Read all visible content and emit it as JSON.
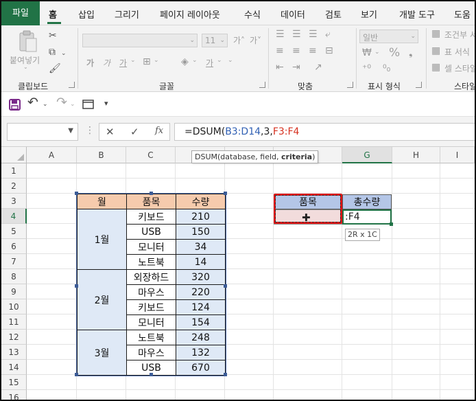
{
  "tabs": [
    "파일",
    "홈",
    "삽입",
    "그리기",
    "페이지 레이아웃",
    "수식",
    "데이터",
    "검토",
    "보기",
    "개발 도구",
    "도움"
  ],
  "ribbon": {
    "clipboard_label": "클립보드",
    "paste_label": "붙여넣기",
    "font_label": "글꼴",
    "font_size": "11",
    "align_label": "맞춤",
    "number_label": "표시 형식",
    "number_format": "일반",
    "style_label": "스타일",
    "cond_format": "조건부 서",
    "table_format": "표 서식",
    "cell_style": "셀 스타일",
    "grow_font": "가˄",
    "shrink_font": "가˅",
    "bold": "가",
    "italic": "가",
    "underline": "가",
    "font_color": "가",
    "percent": "%"
  },
  "quick_access": {
    "icons": [
      "save-icon",
      "undo-icon",
      "redo-icon",
      "window-icon",
      "customize-icon"
    ]
  },
  "formula_bar": {
    "name_box": "",
    "cancel": "✕",
    "enter": "✓",
    "fx": "fx",
    "prefix": "=DSUM(",
    "arg1": "B3:D14",
    "arg2": ",3,",
    "arg3": "F3:F4",
    "tooltip_fn": "DSUM(database, field, ",
    "tooltip_bold": "criteria",
    "tooltip_end": ")"
  },
  "columns": [
    "A",
    "B",
    "C",
    "D",
    "E",
    "F",
    "G",
    "H",
    "I"
  ],
  "rows": [
    "1",
    "2",
    "3",
    "4",
    "5",
    "6",
    "7",
    "8",
    "9",
    "10",
    "11",
    "12",
    "13",
    "14",
    "15",
    "16"
  ],
  "table": {
    "headers": [
      "월",
      "품목",
      "수량"
    ],
    "months": [
      "1월",
      "2월",
      "3월"
    ],
    "items": [
      "키보드",
      "USB",
      "모니터",
      "노트북",
      "외장하드",
      "마우스",
      "키보드",
      "모니터",
      "노트북",
      "마우스",
      "USB"
    ],
    "quantities": [
      "210",
      "150",
      "34",
      "14",
      "320",
      "220",
      "124",
      "154",
      "248",
      "132",
      "670"
    ]
  },
  "criteria": {
    "header_item": "품목",
    "header_total": "총수량",
    "g4_text": ":F4",
    "size_badge": "2R x 1C"
  },
  "colors": {
    "accent": "#217346",
    "header_fill": "#f6cbad",
    "body_fill": "#dfe9f6",
    "criteria_fill": "#b4c6e7",
    "criteria_red": "#e01515"
  }
}
